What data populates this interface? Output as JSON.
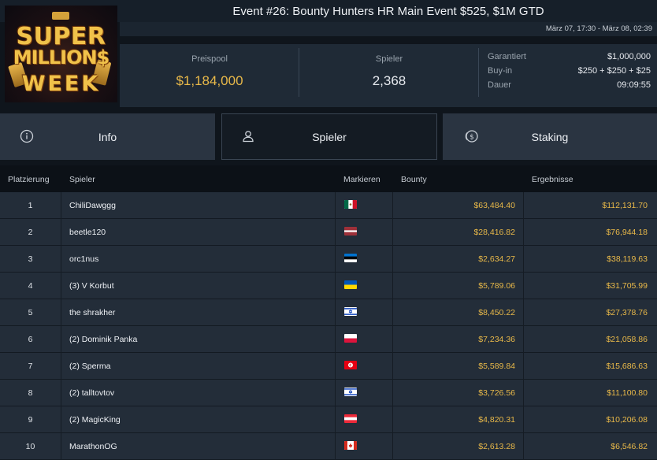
{
  "header": {
    "title": "Event #26: Bounty Hunters HR Main Event $525, $1M GTD",
    "dates": "März 07, 17:30 - März 08, 02:39"
  },
  "logo": {
    "line1": "SUPER",
    "line2": "MILLION$",
    "line3": "WEEK"
  },
  "stats": {
    "prizepool_label": "Preispool",
    "prizepool_value": "$1,184,000",
    "players_label": "Spieler",
    "players_value": "2,368",
    "guaranteed_label": "Garantiert",
    "guaranteed_value": "$1,000,000",
    "buyin_label": "Buy-in",
    "buyin_value": "$250 + $250 + $25",
    "duration_label": "Dauer",
    "duration_value": "09:09:55"
  },
  "tabs": [
    {
      "label": "Info",
      "icon": "info-circle-icon",
      "active": false
    },
    {
      "label": "Spieler",
      "icon": "user-icon",
      "active": true
    },
    {
      "label": "Staking",
      "icon": "dollar-coins-icon",
      "active": false
    }
  ],
  "table": {
    "columns": [
      "Platzierung",
      "Spieler",
      "Markieren",
      "Bounty",
      "Ergebnisse"
    ],
    "rows": [
      {
        "rank": "1",
        "name": "ChiliDawggg",
        "flag": "mexico",
        "bounty": "$63,484.40",
        "result": "$112,131.70"
      },
      {
        "rank": "2",
        "name": "beetle120",
        "flag": "latvia",
        "bounty": "$28,416.82",
        "result": "$76,944.18"
      },
      {
        "rank": "3",
        "name": "orc1nus",
        "flag": "estonia",
        "bounty": "$2,634.27",
        "result": "$38,119.63"
      },
      {
        "rank": "4",
        "name": "(3) V Korbut",
        "flag": "ukraine",
        "bounty": "$5,789.06",
        "result": "$31,705.99"
      },
      {
        "rank": "5",
        "name": "the shrakher",
        "flag": "israel",
        "bounty": "$8,450.22",
        "result": "$27,378.76"
      },
      {
        "rank": "6",
        "name": "(2) Dominik Panka",
        "flag": "poland",
        "bounty": "$7,234.36",
        "result": "$21,058.86"
      },
      {
        "rank": "7",
        "name": "(2) Sperma",
        "flag": "tunisia",
        "bounty": "$5,589.84",
        "result": "$15,686.63"
      },
      {
        "rank": "8",
        "name": "(2) talltovtov",
        "flag": "israel",
        "bounty": "$3,726.56",
        "result": "$11,100.80"
      },
      {
        "rank": "9",
        "name": "(2) MagicKing",
        "flag": "austria",
        "bounty": "$4,820.31",
        "result": "$10,206.08"
      },
      {
        "rank": "10",
        "name": "MarathonOG",
        "flag": "canada",
        "bounty": "$2,613.28",
        "result": "$6,546.82"
      }
    ]
  },
  "colors": {
    "gold": "#e9b949",
    "row_bg": "#232d39",
    "tab_bg": "#2a3441",
    "page_bg": "#0f151c"
  }
}
